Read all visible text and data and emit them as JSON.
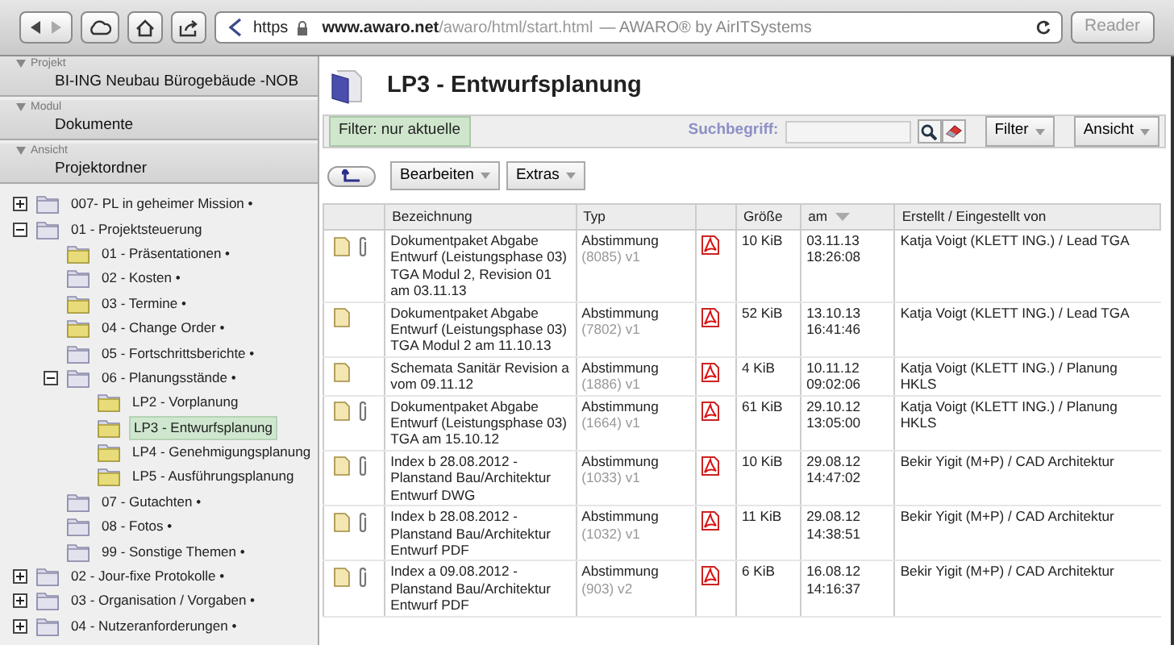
{
  "browser": {
    "scheme": "https",
    "host": "www.awaro.net",
    "path": "/awaro/html/start.html",
    "page_title": "— AWARO® by AirITSystems",
    "reader": "Reader"
  },
  "sidebar": {
    "sections": [
      {
        "label": "Projekt",
        "value": "BI-ING Neubau Bürogebäude -NOB"
      },
      {
        "label": "Modul",
        "value": "Dokumente"
      },
      {
        "label": "Ansicht",
        "value": "Projektordner"
      }
    ],
    "tree": [
      {
        "label": "007- PL in geheimer Mission •",
        "kind": "plain",
        "expanded": false,
        "selected": false
      },
      {
        "label": "01 - Projektsteuerung",
        "kind": "plain",
        "expanded": true,
        "selected": false,
        "children": [
          {
            "label": "01 - Präsentationen •",
            "kind": "filled",
            "selected": false
          },
          {
            "label": "02 - Kosten •",
            "kind": "plain",
            "selected": false
          },
          {
            "label": "03 - Termine •",
            "kind": "filled",
            "selected": false
          },
          {
            "label": "04 - Change Order •",
            "kind": "filled",
            "selected": false
          },
          {
            "label": "05 - Fortschrittsberichte •",
            "kind": "plain",
            "selected": false
          },
          {
            "label": "06 - Planungsstände •",
            "kind": "plain",
            "expanded": true,
            "selected": false,
            "children": [
              {
                "label": "LP2 - Vorplanung",
                "kind": "filled",
                "selected": false
              },
              {
                "label": "LP3 - Entwurfsplanung",
                "kind": "filled",
                "selected": true
              },
              {
                "label": "LP4 - Genehmigungsplanung",
                "kind": "filled",
                "selected": false
              },
              {
                "label": "LP5 - Ausführungsplanung",
                "kind": "filled",
                "selected": false
              }
            ]
          },
          {
            "label": "07 - Gutachten •",
            "kind": "plain",
            "selected": false
          },
          {
            "label": "08 - Fotos •",
            "kind": "plain",
            "selected": false
          },
          {
            "label": "99 - Sonstige Themen •",
            "kind": "plain",
            "selected": false
          }
        ]
      },
      {
        "label": "02 - Jour-fixe Protokolle •",
        "kind": "plain",
        "expanded": false,
        "selected": false
      },
      {
        "label": "03 - Organisation / Vorgaben •",
        "kind": "plain",
        "expanded": false,
        "selected": false
      },
      {
        "label": "04 - Nutzeranforderungen •",
        "kind": "plain",
        "expanded": false,
        "selected": false
      }
    ]
  },
  "main": {
    "title": "LP3 - Entwurfsplanung",
    "filter_chip": "Filter: nur aktuelle",
    "search": {
      "label": "Suchbegriff:"
    },
    "filter_menu": "Filter",
    "view_menu": "Ansicht",
    "actions": [
      "Bearbeiten",
      "Extras"
    ],
    "table": {
      "columns": [
        {
          "label": "Bezeichnung",
          "sorted": false
        },
        {
          "label": "Typ",
          "sorted": false
        },
        {
          "label": "Größe",
          "sorted": false
        },
        {
          "label": "am",
          "sorted": true
        },
        {
          "label": "Erstellt / Eingestellt von",
          "sorted": false
        }
      ],
      "rows": [
        {
          "attachment": true,
          "name": "Dokumentpaket Abgabe Entwurf (Leistungsphase 03) TGA Modul 2, Revision 01 am 03.11.13",
          "type": "Abstimmung",
          "version": "(8085) v1",
          "size": "10 KiB",
          "date": "03.11.13",
          "time": "18:26:08",
          "by": "Katja Voigt (KLETT ING.) / Lead TGA"
        },
        {
          "attachment": false,
          "name": "Dokumentpaket Abgabe Entwurf (Leistungsphase 03) TGA Modul 2 am 11.10.13",
          "type": "Abstimmung",
          "version": "(7802) v1",
          "size": "52 KiB",
          "date": "13.10.13",
          "time": "16:41:46",
          "by": "Katja Voigt (KLETT ING.) / Lead TGA"
        },
        {
          "attachment": false,
          "name": "Schemata Sanitär Revision a vom 09.11.12",
          "type": "Abstimmung",
          "version": "(1886) v1",
          "size": "4 KiB",
          "date": "10.11.12",
          "time": "09:02:06",
          "by": "Katja Voigt (KLETT ING.) / Planung HKLS"
        },
        {
          "attachment": true,
          "name": "Dokumentpaket Abgabe Entwurf (Leistungsphase 03) TGA am 15.10.12",
          "type": "Abstimmung",
          "version": "(1664) v1",
          "size": "61 KiB",
          "date": "29.10.12",
          "time": "13:05:00",
          "by": "Katja Voigt (KLETT ING.) / Planung HKLS"
        },
        {
          "attachment": true,
          "name": "Index b 28.08.2012 - Planstand Bau/Architektur Entwurf DWG",
          "type": "Abstimmung",
          "version": "(1033) v1",
          "size": "10 KiB",
          "date": "29.08.12",
          "time": "14:47:02",
          "by": "Bekir Yigit (M+P) / CAD Architektur"
        },
        {
          "attachment": true,
          "name": "Index b 28.08.2012 - Planstand Bau/Architektur Entwurf PDF",
          "type": "Abstimmung",
          "version": "(1032) v1",
          "size": "11 KiB",
          "date": "29.08.12",
          "time": "14:38:51",
          "by": "Bekir Yigit (M+P) / CAD Architektur"
        },
        {
          "attachment": true,
          "name": "Index a 09.08.2012 - Planstand Bau/Architektur Entwurf PDF",
          "type": "Abstimmung",
          "version": "(903) v2",
          "size": "6 KiB",
          "date": "16.08.12",
          "time": "14:16:37",
          "by": "Bekir Yigit (M+P) / CAD Architektur"
        }
      ]
    }
  }
}
